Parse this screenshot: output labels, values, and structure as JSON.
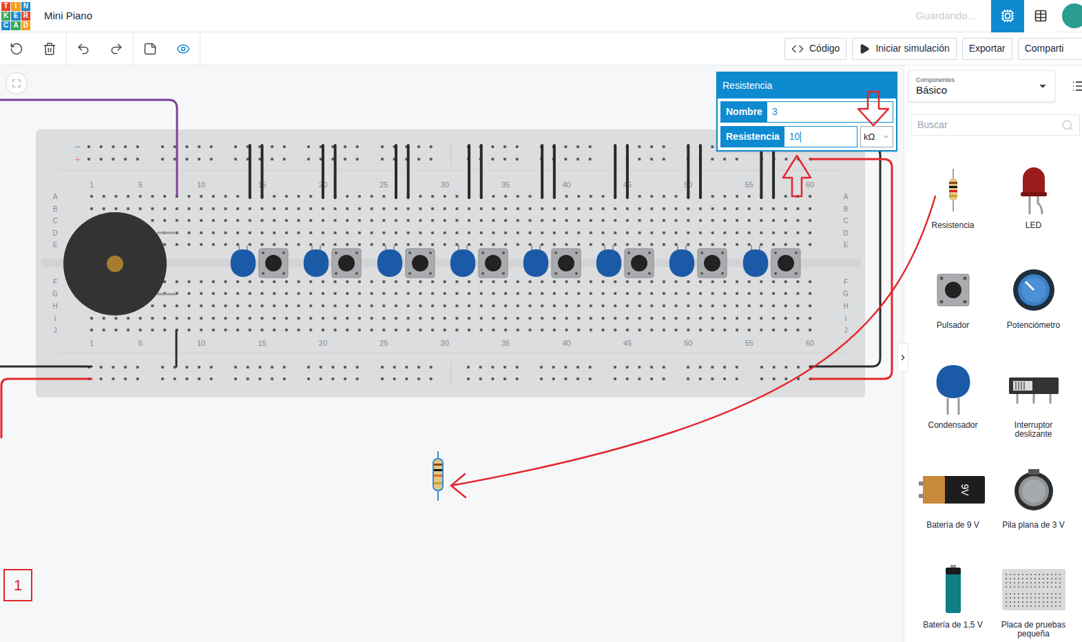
{
  "window": {
    "title": "Mini Piano",
    "status": "Guardando..."
  },
  "logo": [
    {
      "letter": "T",
      "color": "#e7452a"
    },
    {
      "letter": "I",
      "color": "#f59d1d"
    },
    {
      "letter": "N",
      "color": "#1b8bd0"
    },
    {
      "letter": "K",
      "color": "#3aa857"
    },
    {
      "letter": "E",
      "color": "#1b8bd0"
    },
    {
      "letter": "R",
      "color": "#e7452a"
    },
    {
      "letter": "C",
      "color": "#1b8bd0"
    },
    {
      "letter": "A",
      "color": "#3aa857"
    },
    {
      "letter": "D",
      "color": "#f59d1d"
    }
  ],
  "views": [
    {
      "kind": "circuit",
      "selected": true
    },
    {
      "kind": "table",
      "selected": false
    }
  ],
  "tools": [
    {
      "kind": "rotate",
      "selected": false
    },
    {
      "kind": "delete",
      "selected": false
    },
    {
      "kind": "undo",
      "selected": false
    },
    {
      "kind": "redo",
      "selected": false
    },
    {
      "kind": "notes",
      "selected": false
    },
    {
      "kind": "visibility",
      "selected": true
    }
  ],
  "actions": [
    {
      "label": "Código",
      "kind": "code"
    },
    {
      "label": "Iniciar simulación",
      "kind": "play"
    },
    {
      "label": "Exportar",
      "kind": "plain"
    },
    {
      "label": "Comparti",
      "kind": "plain"
    }
  ],
  "breadboard": {
    "rails": [
      {
        "sign": "−",
        "color": "#6b93d6"
      },
      {
        "sign": "+",
        "color": "#f08a8a"
      }
    ],
    "columns": [
      "1",
      "5",
      "10",
      "15",
      "20",
      "25",
      "30",
      "35",
      "40",
      "45",
      "50",
      "55",
      "60"
    ],
    "rows": [
      "A",
      "B",
      "C",
      "D",
      "E",
      "F",
      "G",
      "H",
      "I",
      "J"
    ]
  },
  "popover": {
    "title": "Resistencia",
    "fields": [
      {
        "label": "Nombre",
        "value": "3",
        "focused": false
      },
      {
        "label": "Resistencia",
        "value": "10",
        "unit": "kΩ",
        "focused": true
      }
    ]
  },
  "annotation": "1",
  "panel": {
    "caption": "Componentes",
    "category": "Básico",
    "search_placeholder": "Buscar",
    "components": [
      {
        "label": "Resistencia",
        "kind": "resistor"
      },
      {
        "label": "LED",
        "kind": "led"
      },
      {
        "label": "Pulsador",
        "kind": "button"
      },
      {
        "label": "Potenciómetro",
        "kind": "pot"
      },
      {
        "label": "Condensador",
        "kind": "capacitor"
      },
      {
        "label": "Interruptor deslizante",
        "kind": "switch"
      },
      {
        "label": "Batería de 9 V",
        "kind": "battery9v",
        "icon_text": "9V"
      },
      {
        "label": "Pila plana de 3 V",
        "kind": "coin"
      },
      {
        "label": "Batería de 1,5 V",
        "kind": "aa"
      },
      {
        "label": "Placa de pruebas pequeña",
        "kind": "breadboard"
      }
    ]
  }
}
